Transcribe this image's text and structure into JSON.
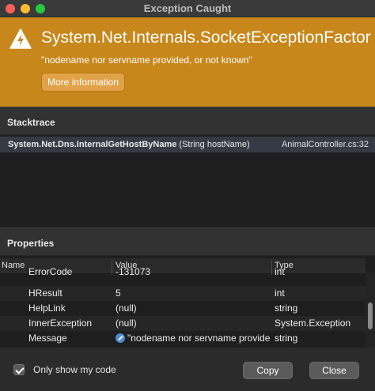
{
  "window": {
    "title": "Exception Caught"
  },
  "banner": {
    "exception_type": "System.Net.Internals.SocketExceptionFactor",
    "message": "\"nodename nor servname provided, or not known\"",
    "more_info_label": "More information",
    "accent_color": "#c8871b"
  },
  "stacktrace": {
    "header": "Stacktrace",
    "frames": [
      {
        "method": "System.Net.Dns.InternalGetHostByName",
        "args": " (String hostName)",
        "location": "AnimalController.cs:32"
      }
    ]
  },
  "properties": {
    "header": "Properties",
    "columns": {
      "name": "Name",
      "value": "Value",
      "type": "Type"
    },
    "rows": [
      {
        "name": "ErrorCode",
        "value": "-131073",
        "type": "int"
      },
      {
        "name": "HResult",
        "value": "5",
        "type": "int"
      },
      {
        "name": "HelpLink",
        "value": "(null)",
        "type": "string"
      },
      {
        "name": "InnerException",
        "value": "(null)",
        "type": "System.Exception"
      },
      {
        "name": "Message",
        "value": "\"nodename nor servname provided",
        "type": "string"
      }
    ]
  },
  "footer": {
    "only_my_code_label": "Only show my code",
    "only_my_code_checked": true,
    "copy_label": "Copy",
    "close_label": "Close"
  }
}
